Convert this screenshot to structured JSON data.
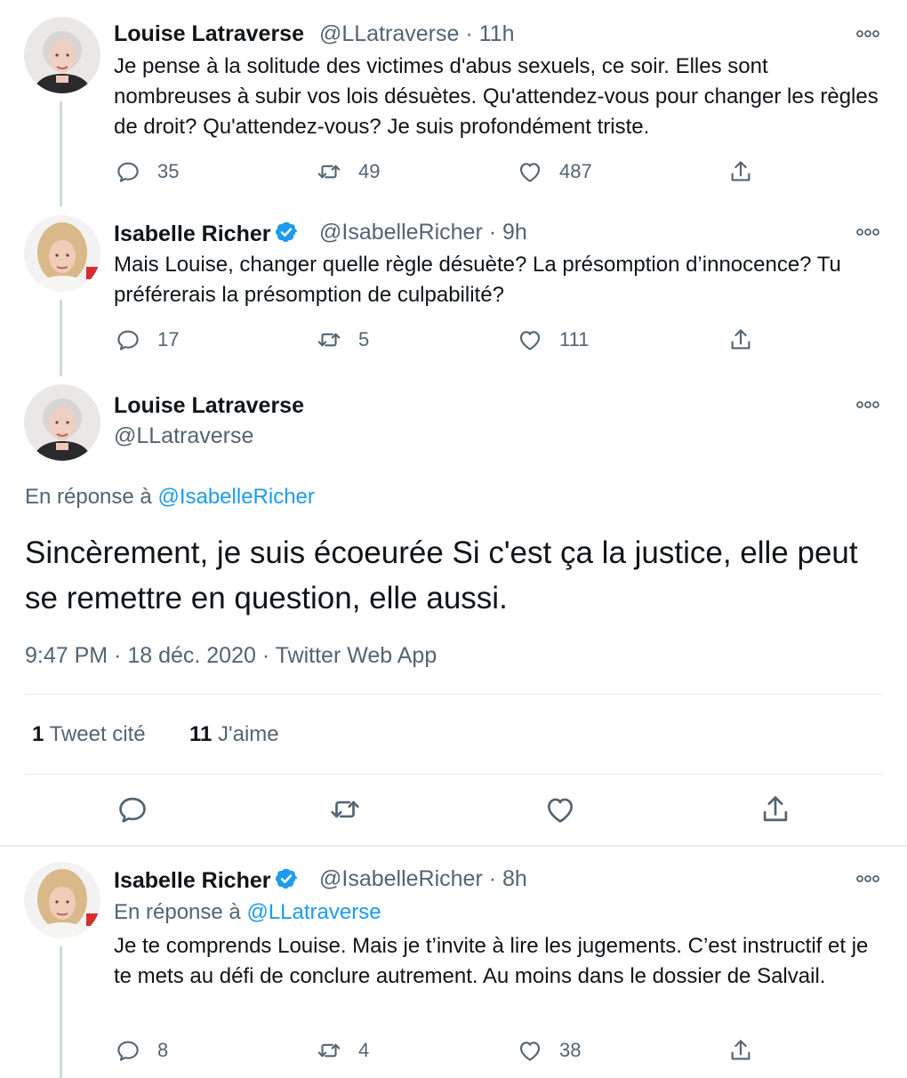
{
  "tweets": [
    {
      "name": "Louise Latraverse",
      "handle": "@LLatraverse",
      "time": "11h",
      "text": "Je pense à la solitude des victimes d'abus sexuels, ce soir. Elles sont nombreuses à subir vos lois désuètes. Qu'attendez-vous pour changer les règles de droit? Qu'attendez-vous? Je suis profondément triste.",
      "replies": "35",
      "retweets": "49",
      "likes": "487"
    },
    {
      "name": "Isabelle Richer",
      "handle": "@IsabelleRicher",
      "time": "9h",
      "verified": true,
      "text": "Mais Louise, changer quelle règle désuète? La présomption d’innocence? Tu préférerais la présomption de culpabilité?",
      "replies": "17",
      "retweets": "5",
      "likes": "111"
    }
  ],
  "main_tweet": {
    "name": "Louise Latraverse",
    "handle": "@LLatraverse",
    "reply_prefix": "En réponse à",
    "reply_to": "@IsabelleRicher",
    "text": "Sincèrement, je suis écoeurée  Si c'est ça la justice, elle peut se remettre en question, elle aussi.",
    "timestamp": "9:47 PM · 18 déc. 2020 · Twitter Web App",
    "quote_count": "1",
    "quote_label": "Tweet cité",
    "like_count": "11",
    "like_label": "J'aime"
  },
  "reply_tweet": {
    "name": "Isabelle Richer",
    "handle": "@IsabelleRicher",
    "time": "8h",
    "verified": true,
    "reply_prefix": "En réponse à",
    "reply_to": "@LLatraverse",
    "text": "Je te comprends Louise. Mais je t’invite à lire les jugements. C’est instructif et je te mets au  défi de conclure autrement. Au moins dans le dossier de Salvail.",
    "replies": "8",
    "retweets": "4",
    "likes": "38"
  },
  "separator": "·",
  "colors": {
    "text": "#0f1419",
    "secondary": "#536471",
    "link": "#1d9bf0",
    "verified": "#1d9bf0",
    "border": "#e6ecf0"
  },
  "icons": [
    "reply-icon",
    "retweet-icon",
    "like-icon",
    "share-icon",
    "more-icon",
    "verified-badge-icon"
  ]
}
